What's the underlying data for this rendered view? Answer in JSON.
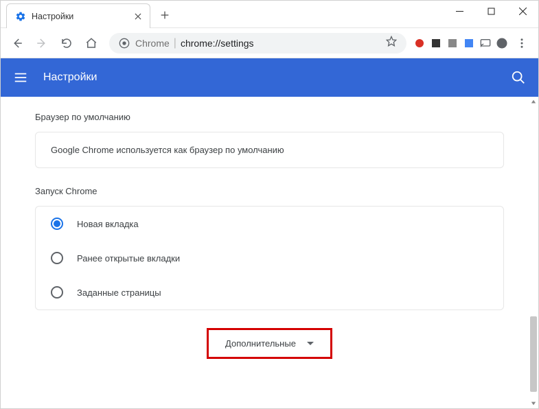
{
  "window": {
    "tab_title": "Настройки"
  },
  "omnibox": {
    "prefix": "Chrome",
    "url": "chrome://settings"
  },
  "header": {
    "title": "Настройки"
  },
  "sections": {
    "default_browser": {
      "label": "Браузер по умолчанию",
      "message": "Google Chrome используется как браузер по умолчанию"
    },
    "on_startup": {
      "label": "Запуск Chrome",
      "options": [
        {
          "label": "Новая вкладка",
          "selected": true
        },
        {
          "label": "Ранее открытые вкладки",
          "selected": false
        },
        {
          "label": "Заданные страницы",
          "selected": false
        }
      ]
    }
  },
  "advanced": {
    "label": "Дополнительные"
  }
}
